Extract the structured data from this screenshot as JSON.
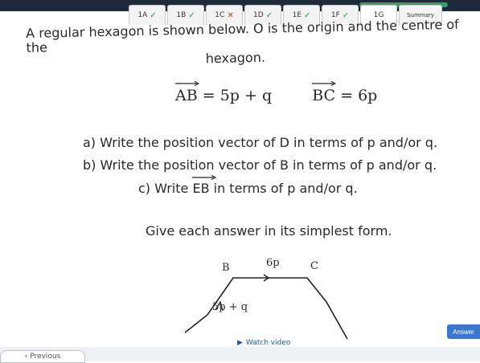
{
  "tabs": [
    {
      "label": "1A",
      "status": "correct"
    },
    {
      "label": "1B",
      "status": "correct"
    },
    {
      "label": "1C",
      "status": "incorrect"
    },
    {
      "label": "1D",
      "status": "correct"
    },
    {
      "label": "1E",
      "status": "correct"
    },
    {
      "label": "1F",
      "status": "correct"
    },
    {
      "label": "1G",
      "status": "current"
    },
    {
      "label": "Summary",
      "status": "none"
    }
  ],
  "question": {
    "intro_line1": "A regular hexagon is shown below. O is the origin and the centre of the",
    "intro_line2": "hexagon.",
    "vector_ab_name": "AB",
    "vector_ab_value": "= 5p + q",
    "vector_bc_name": "BC",
    "vector_bc_value": "= 6p",
    "part_a": "a) Write the position vector of D in terms of p and/or q.",
    "part_b": "b) Write the position vector of B in terms of p and/or q.",
    "part_c_prefix": "c) Write ",
    "part_c_vector": "EB",
    "part_c_suffix": " in terms of p and/or q.",
    "instruction": "Give each answer in its simplest form."
  },
  "diagram": {
    "label_b": "B",
    "label_c": "C",
    "label_top": "6p",
    "label_left": "5p + q"
  },
  "watch_video_label": "Watch video",
  "answer_label": "Answer",
  "previous_label": "Previous",
  "colors": {
    "accent": "#3b78c8",
    "correct": "#2f8f3e",
    "incorrect": "#c0392b",
    "link": "#245e9a"
  }
}
